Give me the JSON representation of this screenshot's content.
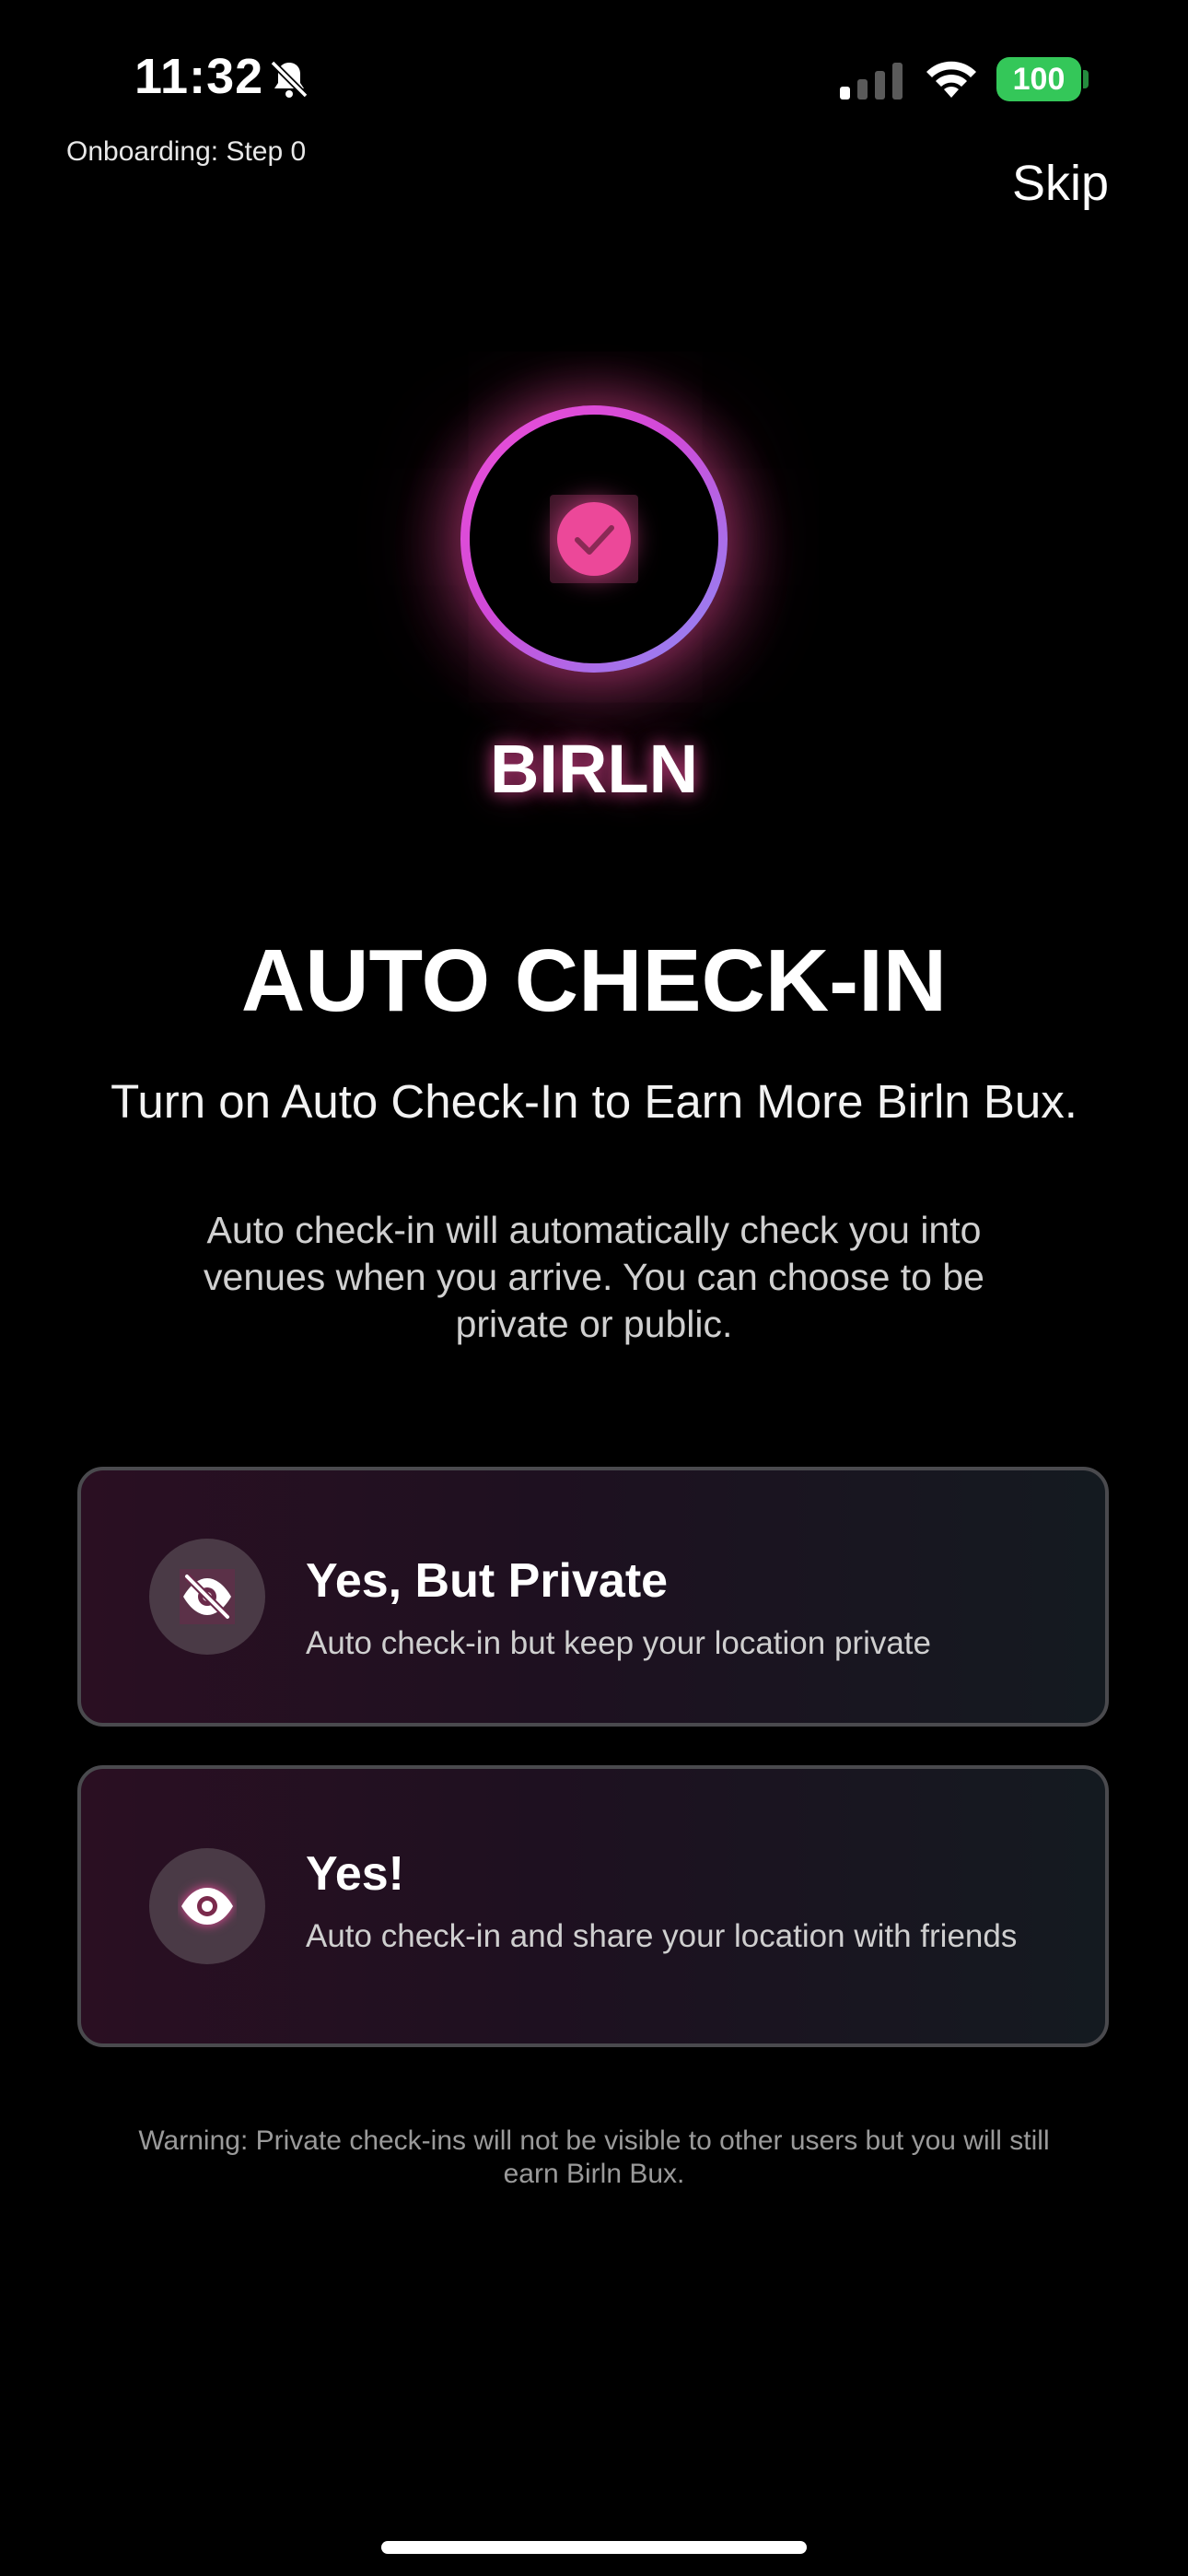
{
  "status_bar": {
    "time": "11:32",
    "battery": "100",
    "icons": [
      "bell-slash-icon",
      "cellular-signal-icon",
      "wifi-icon",
      "battery-icon"
    ]
  },
  "header": {
    "step_label": "Onboarding: Step 0",
    "skip_label": "Skip"
  },
  "brand": {
    "name": "BIRLN",
    "logo_icon": "check-circle-icon",
    "accent_color": "#ec4899",
    "ring_gradient": [
      "#ec4fd8",
      "#8a8cf8"
    ]
  },
  "main": {
    "headline": "AUTO CHECK-IN",
    "subheadline": "Turn on Auto Check-In to Earn More Birln Bux.",
    "description": "Auto check-in will automatically check you into venues when you arrive. You can choose to be private or public."
  },
  "options": [
    {
      "icon": "eye-slash-icon",
      "title": "Yes, But Private",
      "description": "Auto check-in but keep your location private"
    },
    {
      "icon": "eye-icon",
      "title": "Yes!",
      "description": "Auto check-in and share your location with friends"
    }
  ],
  "warning": "Warning: Private check-ins will not be visible to other users but you will still earn Birln Bux."
}
